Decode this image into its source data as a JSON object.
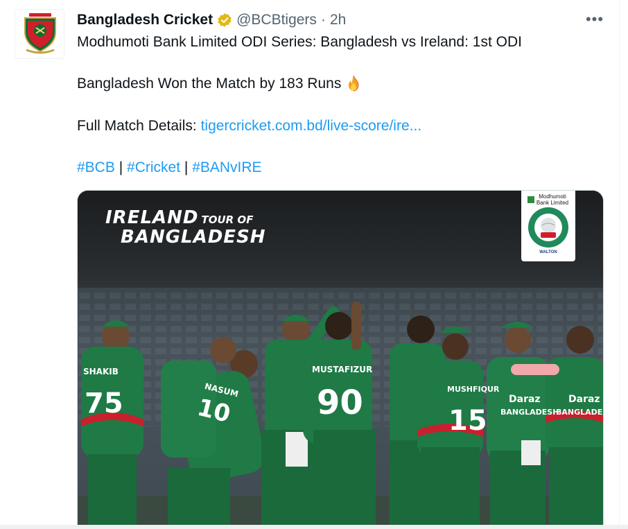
{
  "tweet": {
    "name": "Bangladesh Cricket",
    "handle": "@BCBtigers",
    "dot": "·",
    "time": "2h",
    "more_label": "•••",
    "line1": "Modhumoti Bank Limited ODI Series: Bangladesh vs Ireland: 1st ODI",
    "line2": "Bangladesh Won the Match by 183 Runs",
    "line3_prefix": "Full Match Details: ",
    "line3_link": "tigercricket.com.bd/live-score/ire...",
    "hashtags": [
      "#BCB",
      "#Cricket",
      "#BANvIRE"
    ],
    "hashtag_separator": "|"
  },
  "icons": {
    "verified": "verified-badge-icon",
    "fire": "fire-emoji-icon",
    "more": "more-options-icon"
  },
  "media": {
    "tour_line1": "IRELAND",
    "tour_line1_small": "TOUR OF",
    "tour_line2": "BANGLADESH",
    "sponsor_bank": "Modhumoti Bank Limited",
    "sponsor_bottom": "WALTON",
    "jerseys": [
      {
        "name": "SHAKIB",
        "number": "75"
      },
      {
        "name": "NASUM",
        "number": "10"
      },
      {
        "name": "MUSTAFIZUR",
        "number": "90"
      },
      {
        "name": "MUSHFIQUR",
        "number": "15"
      }
    ],
    "jersey_sponsor": "Daraz",
    "jersey_country": "BANGLADESH"
  },
  "colors": {
    "link": "#1d9bf0",
    "text": "#0f1419",
    "muted": "#536471",
    "verified": "#e2b719",
    "jersey_green": "#1f7a45"
  }
}
